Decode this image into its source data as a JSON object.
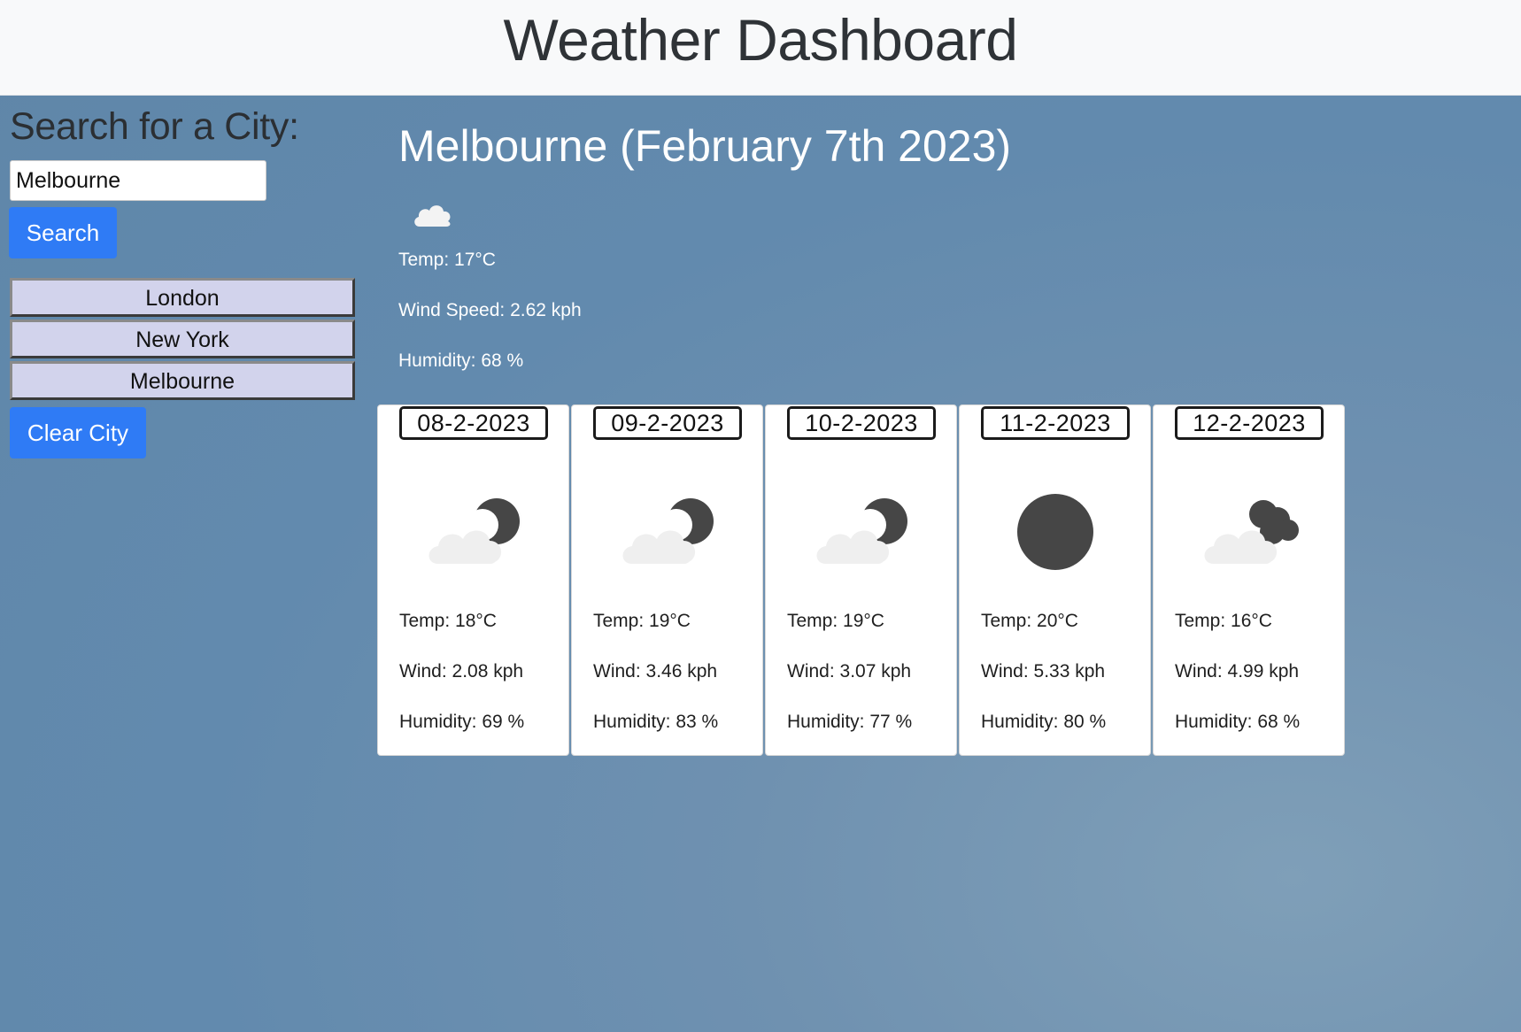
{
  "header": {
    "title": "Weather Dashboard"
  },
  "sidebar": {
    "heading": "Search for a City:",
    "search_value": "Melbourne",
    "search_button": "Search",
    "history": [
      "London",
      "New York",
      "Melbourne"
    ],
    "clear_button": "Clear City"
  },
  "current": {
    "title": "Melbourne (February 7th 2023)",
    "icon": "cloud-icon",
    "temp": "Temp: 17°C",
    "wind": "Wind Speed: 2.62 kph",
    "humidity": "Humidity: 68 %"
  },
  "forecast": [
    {
      "date": "08-2-2023",
      "icon": "partly-cloudy-night-icon",
      "temp": "Temp: 18°C",
      "wind": "Wind: 2.08 kph",
      "humidity": "Humidity: 69 %"
    },
    {
      "date": "09-2-2023",
      "icon": "partly-cloudy-night-icon",
      "temp": "Temp: 19°C",
      "wind": "Wind: 3.46 kph",
      "humidity": "Humidity: 83 %"
    },
    {
      "date": "10-2-2023",
      "icon": "partly-cloudy-night-icon",
      "temp": "Temp: 19°C",
      "wind": "Wind: 3.07 kph",
      "humidity": "Humidity: 77 %"
    },
    {
      "date": "11-2-2023",
      "icon": "clear-night-icon",
      "temp": "Temp: 20°C",
      "wind": "Wind: 5.33 kph",
      "humidity": "Humidity: 80 %"
    },
    {
      "date": "12-2-2023",
      "icon": "cloudy-night-icon",
      "temp": "Temp: 16°C",
      "wind": "Wind: 4.99 kph",
      "humidity": "Humidity: 68 %"
    }
  ],
  "colors": {
    "accent": "#2f7bf5",
    "history_bg": "#d2d3ec",
    "header_bg": "#f8f9fa",
    "page_bg": "#628aae"
  }
}
